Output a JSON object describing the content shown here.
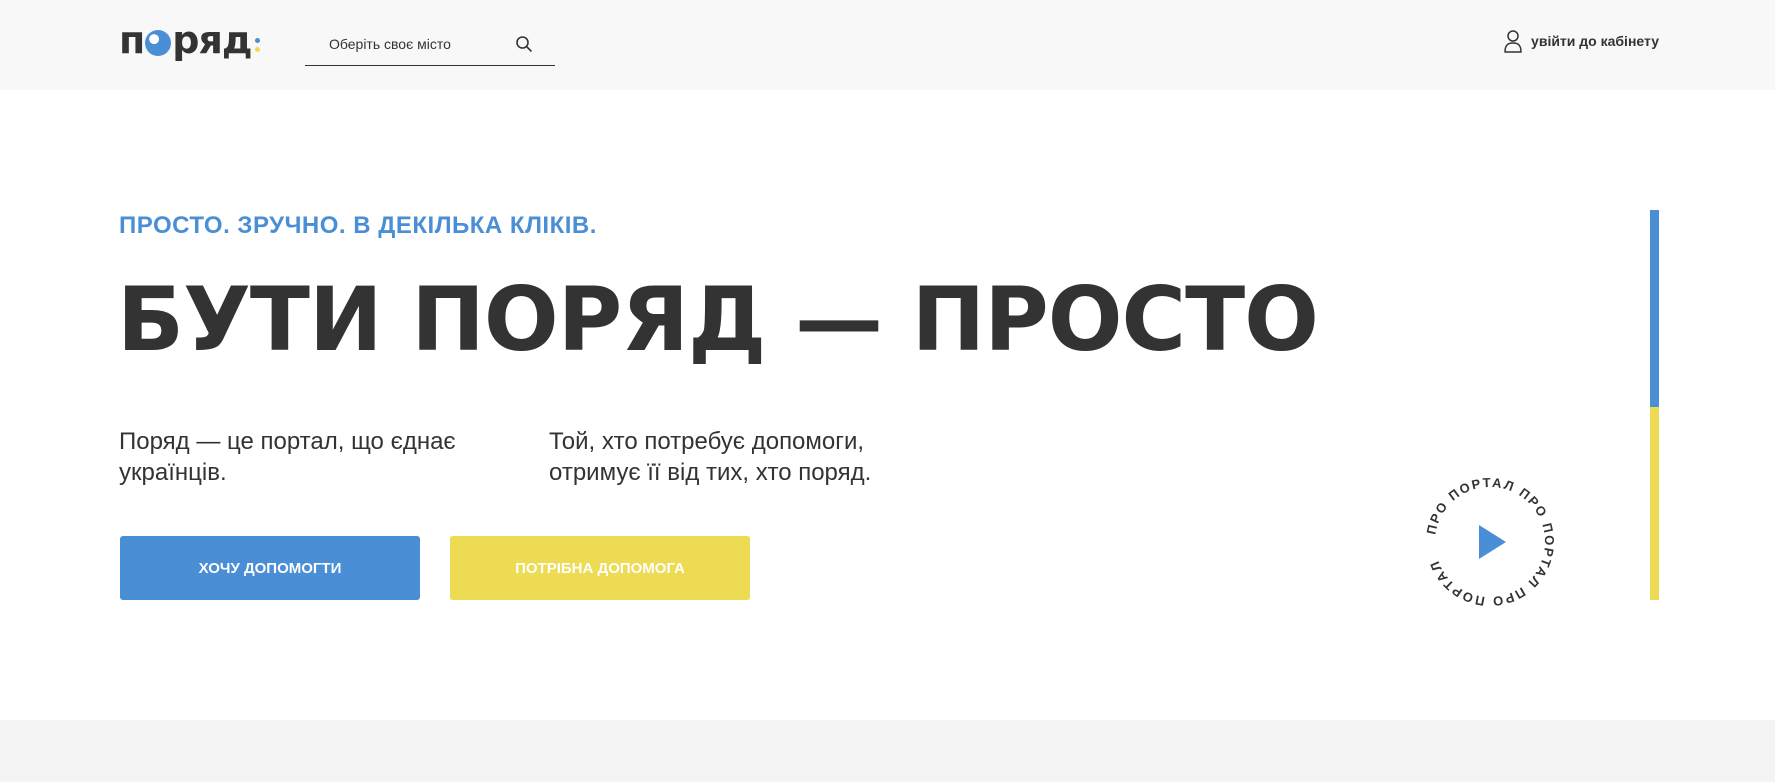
{
  "header": {
    "logo_text": "поряд",
    "logo_letters_before": "п",
    "logo_letters_after": "ряд",
    "search_placeholder": "Оберіть своє місто",
    "login_label": "увійти до кабінету"
  },
  "hero": {
    "tagline": "ПРОСТО. ЗРУЧНО. В ДЕКІЛЬКА КЛІКІВ.",
    "headline": "БУТИ ПОРЯД — ПРОСТО",
    "description_left": "Поряд — це портал, що єднає українців.",
    "description_right": "Той, хто потребує допомоги, отримує її від тих, хто поряд.",
    "button_help": "ХОЧУ ДОПОМОГТИ",
    "button_need_help": "ПОТРІБНА ДОПОМОГА",
    "about_portal_circle_text": "ПРО ПОРТАЛ ПРО ПОРТАЛ ПРО ПОРТАЛ"
  },
  "icons": {
    "search": "search-icon",
    "user": "user-icon",
    "play": "play-icon"
  },
  "colors": {
    "accent_blue": "#4a8fd6",
    "accent_yellow": "#eedb54",
    "text_dark": "#333333",
    "header_bg": "#f8f8f8"
  }
}
